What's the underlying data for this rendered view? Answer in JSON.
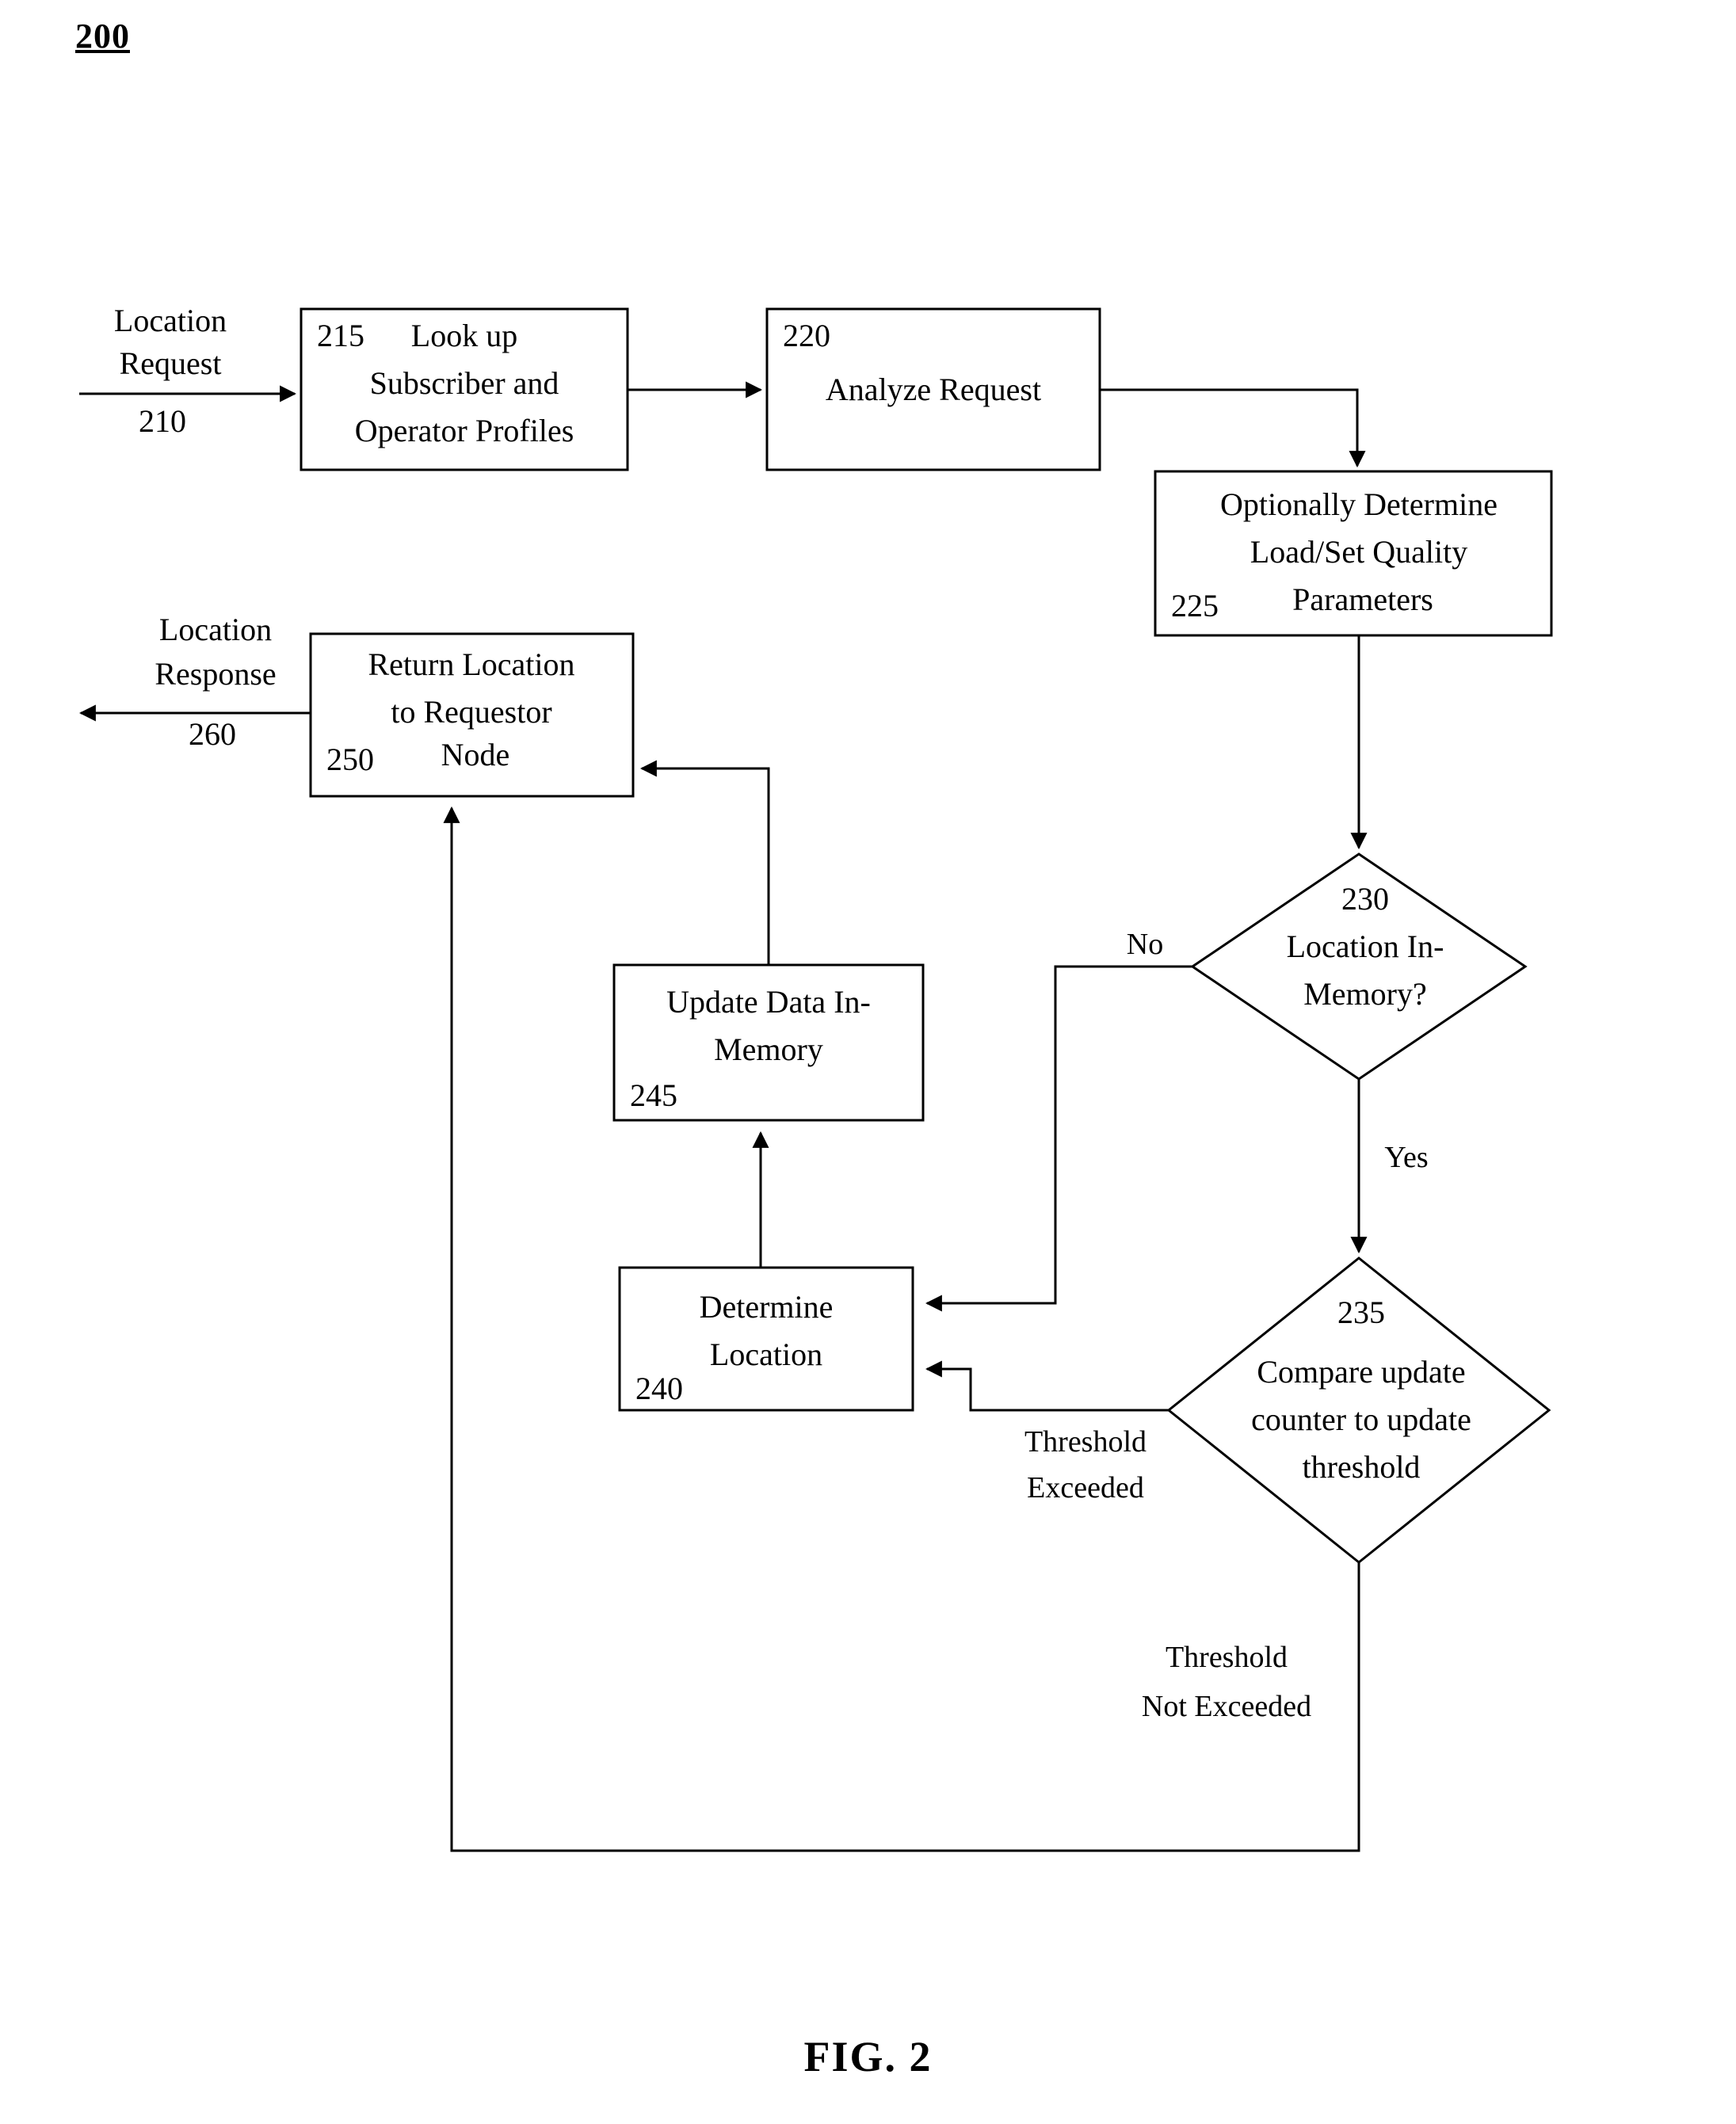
{
  "figure": {
    "ref_number": "200",
    "caption": "FIG. 2"
  },
  "io_labels": {
    "request_line1": "Location",
    "request_line2": "Request",
    "request_num": "210",
    "response_line1": "Location",
    "response_line2": "Response",
    "response_num": "260"
  },
  "nodes": {
    "n215": {
      "num": "215",
      "line1": "Look up",
      "line2": "Subscriber and",
      "line3": "Operator Profiles"
    },
    "n220": {
      "num": "220",
      "line1": "Analyze Request"
    },
    "n225": {
      "num": "225",
      "line1": "Optionally Determine",
      "line2": "Load/Set Quality",
      "line3": "Parameters"
    },
    "n230": {
      "num": "230",
      "line1": "Location In-",
      "line2": "Memory?"
    },
    "n235": {
      "num": "235",
      "line1": "Compare update",
      "line2": "counter to update",
      "line3": "threshold"
    },
    "n240": {
      "num": "240",
      "line1": "Determine",
      "line2": "Location"
    },
    "n245": {
      "num": "245",
      "line1": "Update Data In-",
      "line2": "Memory"
    },
    "n250": {
      "num": "250",
      "line1": "Return Location",
      "line2": "to Requestor",
      "line3": "Node"
    }
  },
  "edge_labels": {
    "no": "No",
    "yes": "Yes",
    "threshold_exceeded_l1": "Threshold",
    "threshold_exceeded_l2": "Exceeded",
    "threshold_not_exceeded_l1": "Threshold",
    "threshold_not_exceeded_l2": "Not Exceeded"
  },
  "colors": {
    "stroke": "#000000",
    "fill": "#ffffff",
    "text": "#000000"
  }
}
